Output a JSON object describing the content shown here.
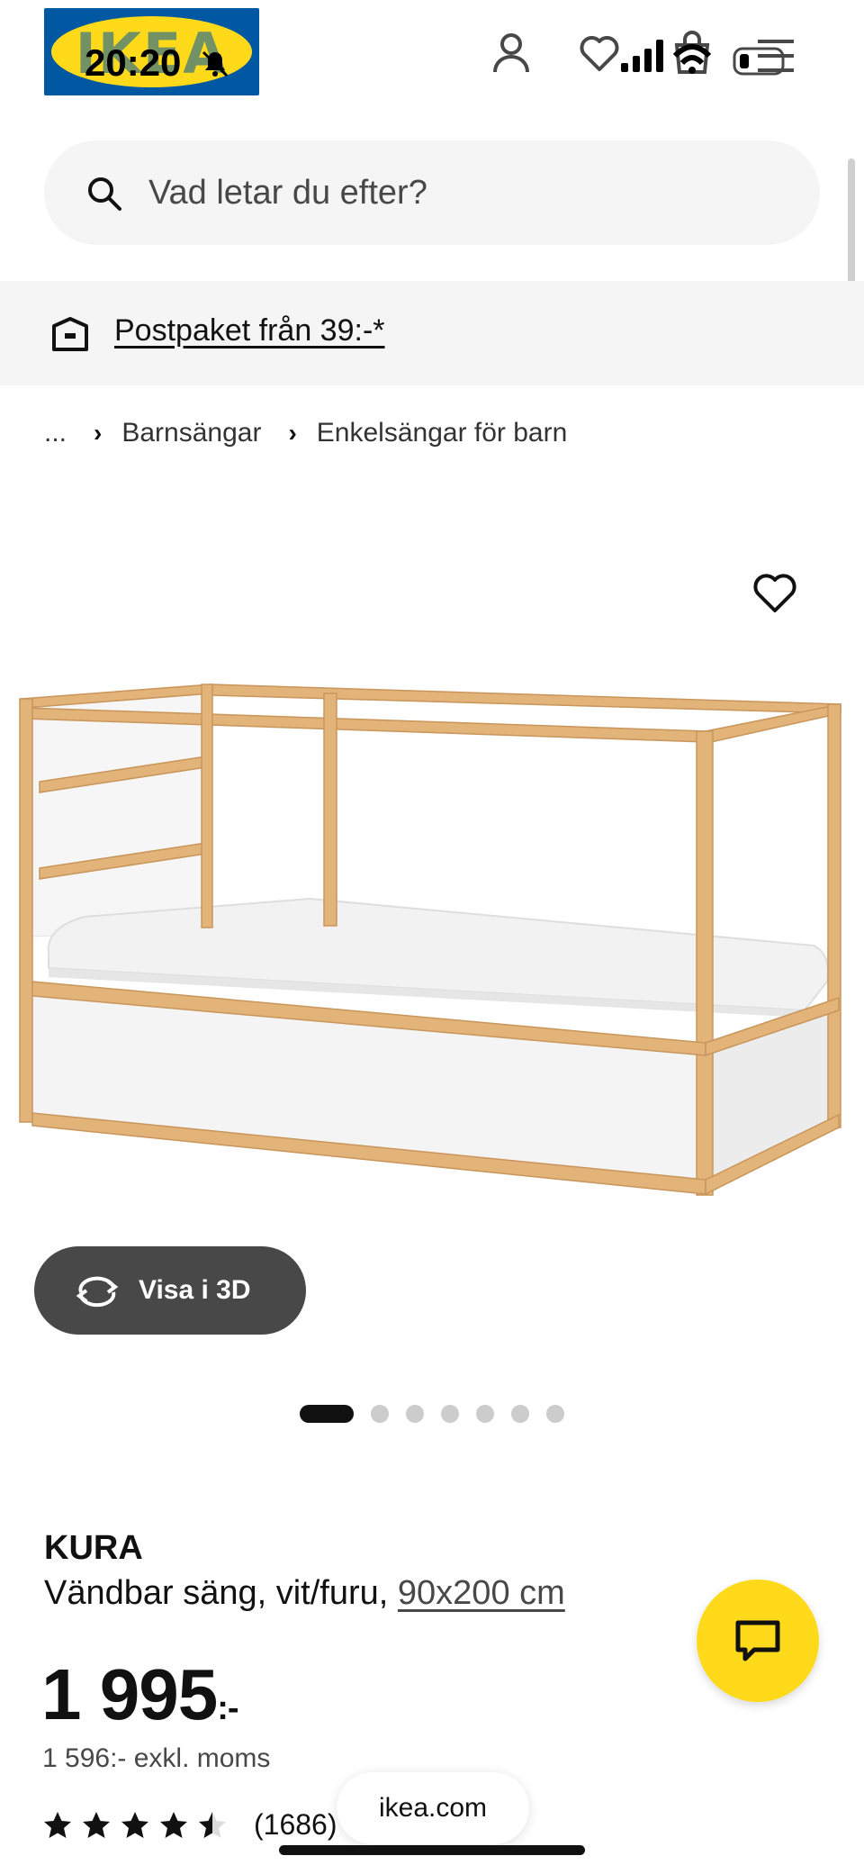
{
  "status_bar": {
    "time": "20:20"
  },
  "header": {
    "logo_text": "IKEA",
    "icons": [
      "profile-icon",
      "heart-icon",
      "shopping-bag-icon",
      "menu-icon"
    ]
  },
  "search": {
    "placeholder": "Vad letar du efter?"
  },
  "promo": {
    "link_text": "Postpaket från 39:-*"
  },
  "breadcrumb": {
    "items": [
      "...",
      "Barnsängar",
      "Enkelsängar för barn"
    ]
  },
  "media": {
    "view_3d_label": "Visa i 3D",
    "total_images": 7,
    "active_image_index": 0
  },
  "product": {
    "name": "KURA",
    "description": "Vändbar säng, vit/furu,",
    "size": "90x200 cm",
    "price": "1 995",
    "price_suffix": ":-",
    "price_ex_vat": "1 596:- exkl. moms",
    "rating_value": 4.5,
    "rating_max": 5,
    "review_count": "(1686)"
  },
  "browser": {
    "url": "ikea.com"
  },
  "colors": {
    "ikea_blue": "#0058a3",
    "ikea_yellow": "#ffda1a",
    "button_dark": "#484848",
    "surface_grey": "#f5f5f5",
    "pine": "#e2b47a"
  }
}
